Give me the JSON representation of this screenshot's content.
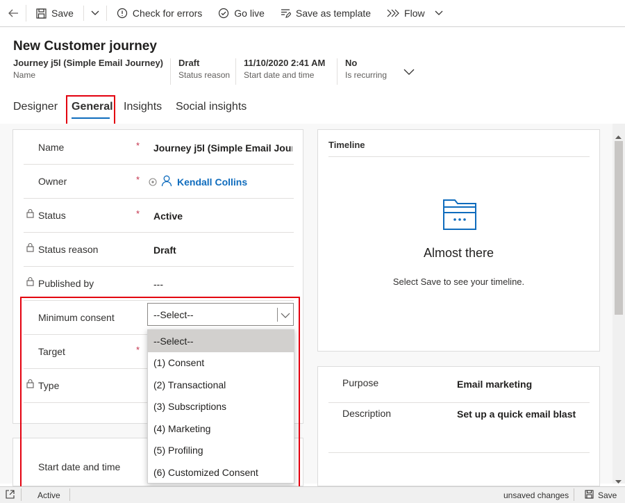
{
  "toolbar": {
    "save": "Save",
    "check_errors": "Check for errors",
    "go_live": "Go live",
    "save_template": "Save as template",
    "flow": "Flow"
  },
  "header": {
    "title": "New Customer journey",
    "fields": [
      {
        "value": "Journey j5l (Simple Email Journey)",
        "label": "Name"
      },
      {
        "value": "Draft",
        "label": "Status reason"
      },
      {
        "value": "11/10/2020 2:41 AM",
        "label": "Start date and time"
      },
      {
        "value": "No",
        "label": "Is recurring"
      }
    ]
  },
  "tabs": [
    "Designer",
    "General",
    "Insights",
    "Social insights"
  ],
  "active_tab": "General",
  "general": {
    "rows": [
      {
        "label": "Name",
        "value": "Journey j5l (Simple Email Jour...",
        "required": "*"
      },
      {
        "label": "Owner",
        "value": "Kendall Collins",
        "required": "*"
      },
      {
        "label": "Status",
        "value": "Active",
        "required": "*"
      },
      {
        "label": "Status reason",
        "value": "Draft"
      },
      {
        "label": "Published by",
        "value": "---"
      },
      {
        "label": "Minimum consent"
      },
      {
        "label": "Target",
        "required": "*"
      },
      {
        "label": "Type"
      }
    ],
    "start_label": "Start date and time"
  },
  "consent_select": {
    "value": "--Select--",
    "options": [
      "--Select--",
      "(1) Consent",
      "(2) Transactional",
      "(3) Subscriptions",
      "(4) Marketing",
      "(5) Profiling",
      "(6) Customized Consent"
    ]
  },
  "timeline": {
    "title": "Timeline",
    "heading": "Almost there",
    "message": "Select Save to see your timeline."
  },
  "info": {
    "purpose_label": "Purpose",
    "purpose_value": "Email marketing",
    "description_label": "Description",
    "description_value": "Set up a quick email blast"
  },
  "status_bar": {
    "status": "Active",
    "unsaved": "unsaved changes",
    "save": "Save"
  },
  "colors": {
    "accent": "#0f6cbd",
    "link": "#0f6cbd",
    "highlight_red": "#e3000f",
    "required": "#c4314b"
  }
}
